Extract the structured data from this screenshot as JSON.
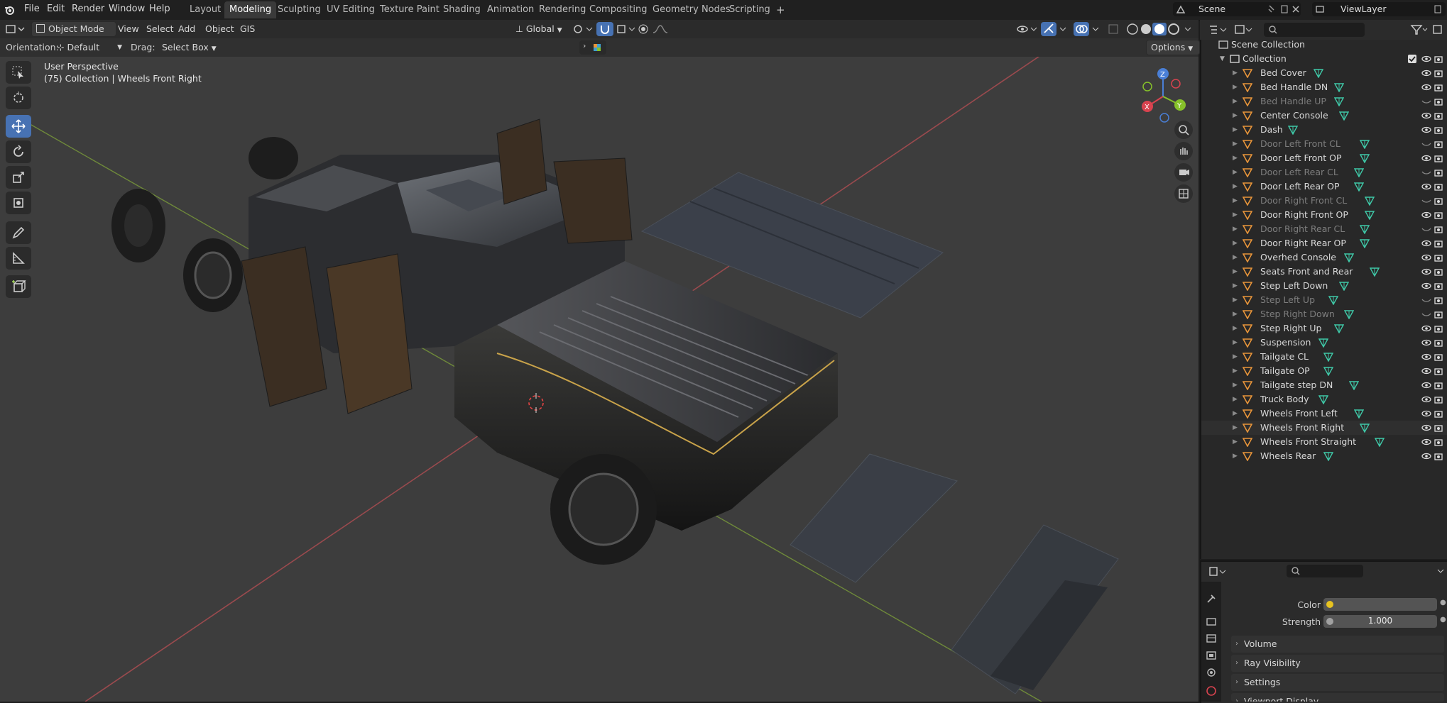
{
  "topbar": {
    "menus": [
      "File",
      "Edit",
      "Render",
      "Window",
      "Help"
    ],
    "workspaces": [
      "Layout",
      "Modeling",
      "Sculpting",
      "UV Editing",
      "Texture Paint",
      "Shading",
      "Animation",
      "Rendering",
      "Compositing",
      "Geometry Nodes",
      "Scripting"
    ],
    "active_workspace": "Modeling",
    "add_tab": "+",
    "scene_name": "Scene",
    "view_layer": "ViewLayer"
  },
  "viewport_header": {
    "mode": "Object Mode",
    "menus": [
      "View",
      "Select",
      "Add",
      "Object",
      "GIS"
    ],
    "transform_orientation": "Global"
  },
  "tool_settings": {
    "orientation_label": "Orientation:",
    "orientation_value": "Default",
    "drag_label": "Drag:",
    "drag_value": "Select Box",
    "options": "Options"
  },
  "viewport_info": {
    "perspective": "User Perspective",
    "collection_info": "(75) Collection | Wheels Front Right"
  },
  "gizmo": {
    "x": "X",
    "y": "Y",
    "z": "Z"
  },
  "outliner": {
    "scene_collection": "Scene Collection",
    "collection": "Collection",
    "objects": [
      {
        "name": "Bed Cover",
        "visible": true
      },
      {
        "name": "Bed Handle DN",
        "visible": true
      },
      {
        "name": "Bed Handle UP",
        "visible": false
      },
      {
        "name": "Center Console",
        "visible": true
      },
      {
        "name": "Dash",
        "visible": true
      },
      {
        "name": "Door Left Front CL",
        "visible": false
      },
      {
        "name": "Door Left Front OP",
        "visible": true
      },
      {
        "name": "Door Left Rear CL",
        "visible": false
      },
      {
        "name": "Door Left Rear OP",
        "visible": true
      },
      {
        "name": "Door Right Front CL",
        "visible": false
      },
      {
        "name": "Door Right Front OP",
        "visible": true
      },
      {
        "name": "Door Right Rear CL",
        "visible": false
      },
      {
        "name": "Door Right Rear OP",
        "visible": true
      },
      {
        "name": "Overhed Console",
        "visible": true
      },
      {
        "name": "Seats Front and Rear",
        "visible": true
      },
      {
        "name": "Step Left Down",
        "visible": true
      },
      {
        "name": "Step Left Up",
        "visible": false
      },
      {
        "name": "Step Right Down",
        "visible": false
      },
      {
        "name": "Step Right Up",
        "visible": true
      },
      {
        "name": "Suspension",
        "visible": true
      },
      {
        "name": "Tailgate CL",
        "visible": true
      },
      {
        "name": "Tailgate OP",
        "visible": true
      },
      {
        "name": "Tailgate step DN",
        "visible": true
      },
      {
        "name": "Truck Body",
        "visible": true
      },
      {
        "name": "Wheels Front Left",
        "visible": true
      },
      {
        "name": "Wheels Front Right",
        "visible": true
      },
      {
        "name": "Wheels Front Straight",
        "visible": true
      },
      {
        "name": "Wheels Rear",
        "visible": true
      }
    ]
  },
  "properties": {
    "color_label": "Color",
    "strength_label": "Strength",
    "strength_value": "1.000",
    "panels": [
      "Volume",
      "Ray Visibility",
      "Settings",
      "Viewport Display"
    ]
  },
  "colors": {
    "accent": "#4772b3",
    "object_icon": "#e8953a",
    "mesh_icon": "#3fc9a8",
    "x_axis": "#d8434f",
    "y_axis": "#86c12a",
    "z_axis": "#4a7fd6"
  }
}
